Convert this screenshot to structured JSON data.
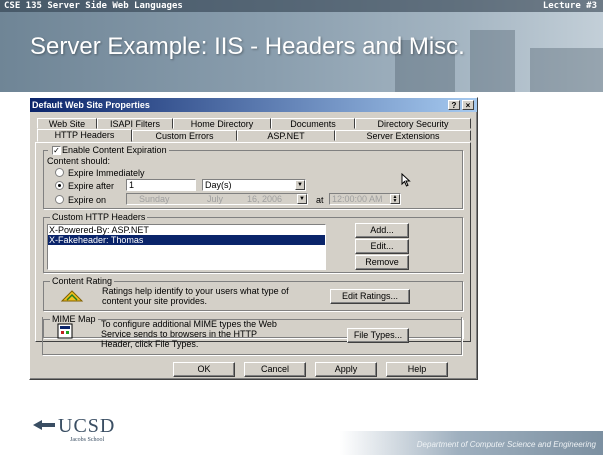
{
  "slide": {
    "course": "CSE 135    Server Side Web Languages",
    "lecture": "Lecture #3",
    "title": "Server Example: IIS - Headers and Misc.",
    "logo_text": "UCSD",
    "logo_subtext": "Jacobs School",
    "footer": "Department of Computer Science and Engineering"
  },
  "dialog": {
    "title": "Default Web Site Properties",
    "help_button": "?",
    "close_button": "×",
    "tabs_back": [
      "Web Site",
      "ISAPI Filters",
      "Home Directory",
      "Documents",
      "Directory Security"
    ],
    "tabs_front": [
      "HTTP Headers",
      "Custom Errors",
      "ASP.NET",
      "Server Extensions"
    ],
    "active_tab": "HTTP Headers",
    "expiration": {
      "enable_label": "Enable Content Expiration",
      "enabled": true,
      "content_should": "Content should:",
      "options": [
        "Expire Immediately",
        "Expire after",
        "Expire on"
      ],
      "selected_option": "Expire after",
      "after_value": "1",
      "after_unit": "Day(s)",
      "on_date": {
        "day": "Sunday",
        "month": "July",
        "date": "16, 2006"
      },
      "at_label": "at",
      "on_time": "12:00:00 AM"
    },
    "custom_headers": {
      "label": "Custom HTTP Headers",
      "items": [
        "X-Powered-By: ASP.NET",
        "X-Fakeheader: Thomas"
      ],
      "selected_index": 1,
      "buttons": {
        "add": "Add...",
        "edit": "Edit...",
        "remove": "Remove"
      }
    },
    "content_rating": {
      "label": "Content Rating",
      "text_line1": "Ratings help identify to your users what type of",
      "text_line2": "content your site provides.",
      "button": "Edit Ratings..."
    },
    "mime_map": {
      "label": "MIME Map",
      "text_line1": "To configure additional MIME types the Web",
      "text_line2": "Service sends to browsers in the HTTP",
      "text_line3": "Header, click File Types.",
      "button": "File Types..."
    },
    "footer_buttons": {
      "ok": "OK",
      "cancel": "Cancel",
      "apply": "Apply",
      "help": "Help"
    }
  },
  "colors": {
    "titlebar_start": "#0a246a",
    "titlebar_end": "#a6caf0",
    "dialog_face": "#d4d0c8",
    "selection": "#0a246a"
  }
}
